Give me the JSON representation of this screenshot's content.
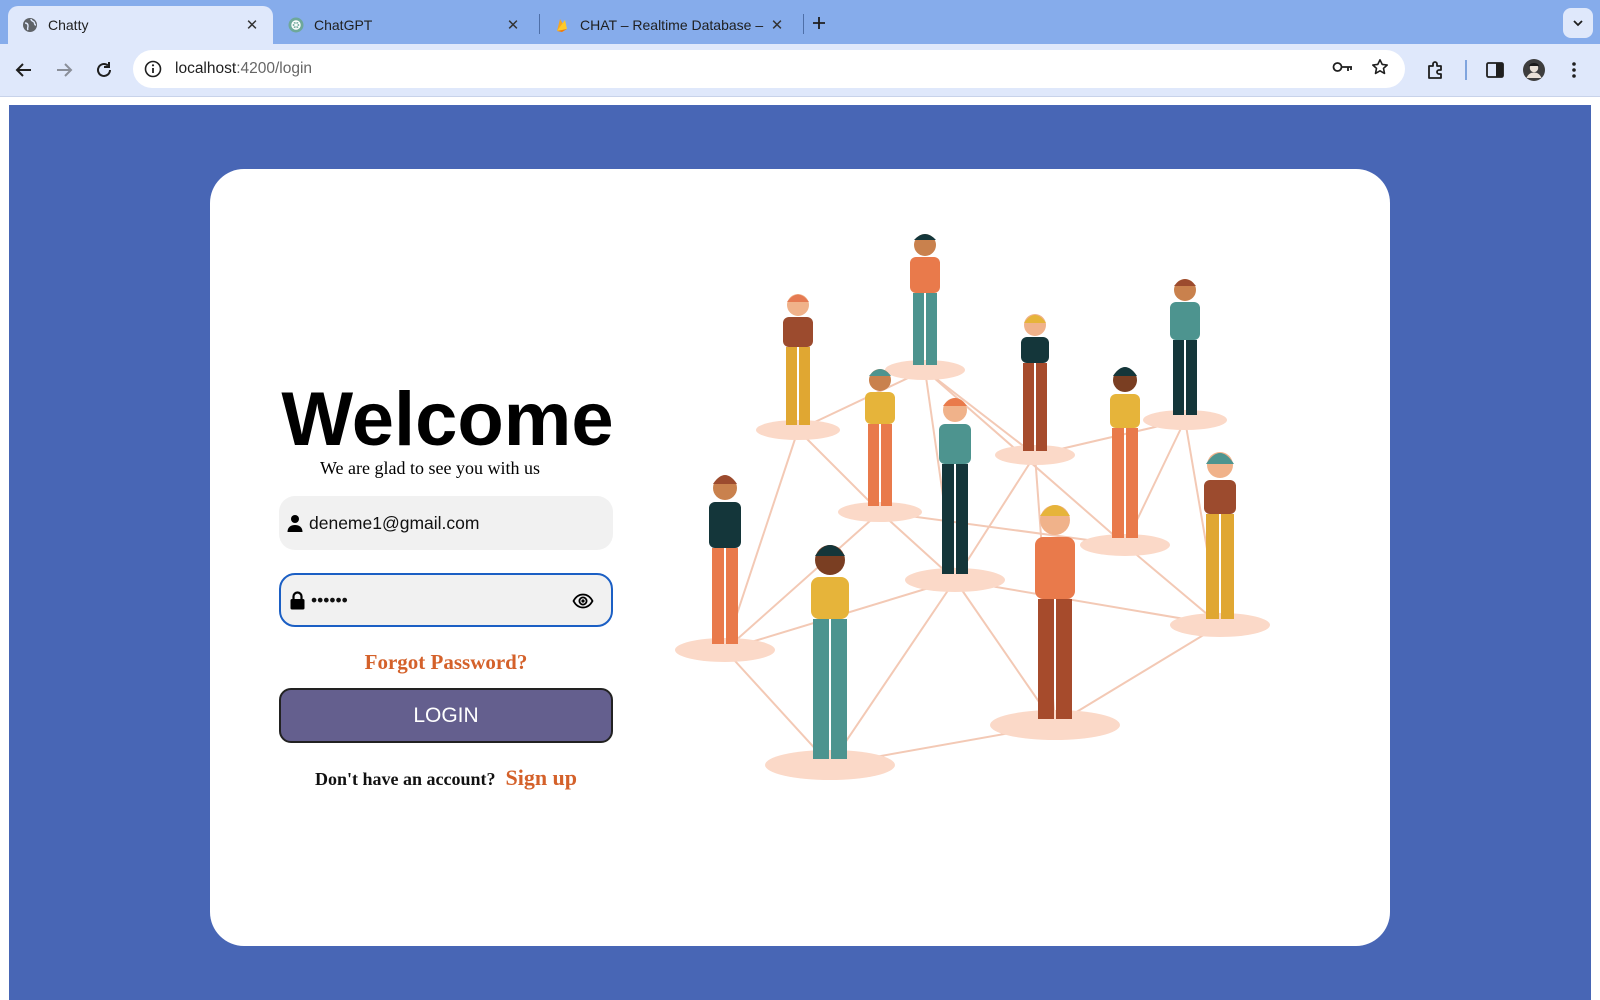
{
  "browser": {
    "tabs": [
      {
        "title": "Chatty",
        "active": true,
        "icon": "globe-icon"
      },
      {
        "title": "ChatGPT",
        "active": false,
        "icon": "openai-icon"
      },
      {
        "title": "CHAT – Realtime Database –",
        "active": false,
        "icon": "firebase-icon"
      }
    ],
    "url_host": "localhost",
    "url_path": ":4200/login"
  },
  "login": {
    "title": "Welcome",
    "subtitle": "We are glad to see you with us",
    "email_value": "deneme1@gmail.com",
    "password_value": "••••••",
    "forgot_label": "Forgot Password?",
    "login_label": "LOGIN",
    "no_account_text": "Don't have an account?",
    "signup_label": "Sign up"
  },
  "colors": {
    "page_background": "#4866b5",
    "card": "#ffffff",
    "accent_link": "#d4612a",
    "login_button": "#645f8e",
    "focus_border": "#1b5fc4"
  }
}
